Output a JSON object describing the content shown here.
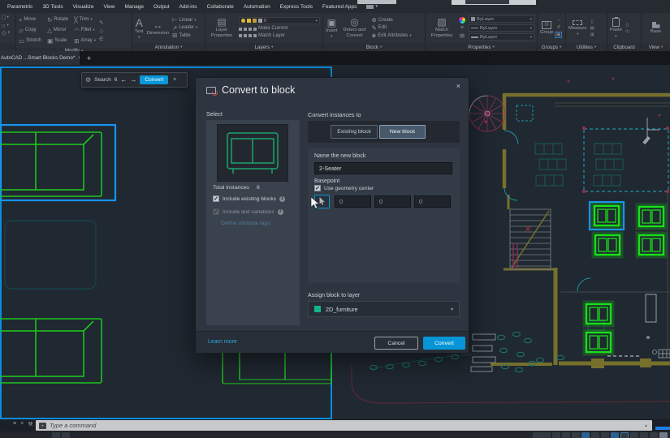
{
  "app": {
    "drawing_tab": "AutoCAD ...Smart Blocks Demo*"
  },
  "menu": {
    "items": [
      "Parametric",
      "3D Tools",
      "Visualize",
      "View",
      "Manage",
      "Output",
      "Add-ins",
      "Collaborate",
      "Automation",
      "Express Tools",
      "Featured Apps"
    ]
  },
  "ribbon": {
    "modify": {
      "label": "Modify",
      "move": "Move",
      "rotate": "Rotate",
      "trim": "Trim",
      "copy": "Copy",
      "mirror": "Mirror",
      "fillet": "Fillet",
      "stretch": "Stretch",
      "scale": "Scale",
      "array": "Array"
    },
    "annotation": {
      "label": "Annotation",
      "text": "Text",
      "dimension": "Dimension",
      "linear": "Linear",
      "leader": "Leader",
      "table": "Table"
    },
    "layers": {
      "label": "Layers",
      "layer_properties": "Layer Properties",
      "current_layer": "0",
      "make_current": "Make Current",
      "match_layer": "Match Layer"
    },
    "block": {
      "label": "Block",
      "insert": "Insert",
      "detect_convert": "Detect and Convert",
      "create": "Create",
      "edit": "Edit",
      "edit_attributes": "Edit Attributes"
    },
    "properties": {
      "label": "Properties",
      "match_properties": "Match Properties",
      "bylayer_color": "ByLayer",
      "bylayer_linetype": "ByLayer",
      "bylayer_lineweight": "ByLayer"
    },
    "groups": {
      "label": "Groups",
      "group": "Group"
    },
    "utilities": {
      "label": "Utilities",
      "measure": "Measure"
    },
    "clipboard": {
      "label": "Clipboard",
      "paste": "Paste"
    },
    "view": {
      "label": "View",
      "base": "Base"
    }
  },
  "finder": {
    "search_label": "Search",
    "count": "6",
    "convert": "Convert"
  },
  "dialog": {
    "title": "Convert to block",
    "select": {
      "label": "Select",
      "total_label": "Total instances",
      "total_value": "6",
      "include_existing": "Include existing blocks",
      "include_text": "Include text variations",
      "define_tags": "Define attribute tags"
    },
    "convert_to": {
      "label": "Convert instances to",
      "existing_tab": "Existing block",
      "new_tab": "New block"
    },
    "name": {
      "label": "Name the new block",
      "value": "2-Seater"
    },
    "basepoint": {
      "label": "Basepoint",
      "geometry_center": "Use geometry center",
      "x": "0",
      "y": "0",
      "z": "0"
    },
    "assign": {
      "label": "Assign block to layer",
      "layer": "2D_furniture"
    },
    "footer": {
      "learn_more": "Learn more",
      "cancel": "Cancel",
      "convert": "Convert"
    }
  },
  "commandline": {
    "placeholder": "Type a command"
  },
  "icons": {
    "caret": "▾",
    "gear": "⚙",
    "arrow_left": "←",
    "arrow_right": "→",
    "close": "×",
    "check": "✓",
    "info": "i",
    "move": "+",
    "rotate": "↻",
    "trim": "╳",
    "copy": "▱",
    "mirror": "△",
    "fillet": "◠",
    "stretch": "▭",
    "scale": "▣",
    "array": "⊞",
    "pencil": "✎",
    "polygon": "◇",
    "member": "∈",
    "text": "A",
    "dimension": "↔",
    "linear": "⊢",
    "leader": "↗",
    "table": "⊞",
    "layer_stack": "▤",
    "insert": "▣",
    "detect": "◎",
    "create": "⊕",
    "edit": "✎",
    "edit_attr": "◈",
    "match_props": "▨",
    "group": "⊙",
    "menu_list": "≡",
    "wrench": "⚒",
    "up": "▴",
    "rect_tool": "□",
    "circle_tool": "○",
    "poly_tool": "◇",
    "g1": "▫",
    "g2": "↺",
    "g3": "▦",
    "u1": "▯",
    "u2": "▤",
    "u3": "⊞",
    "c1": "▯",
    "c2": "▭"
  },
  "colors": {
    "accent_blue": "#0696d7",
    "selection_blue": "#1794f0",
    "block_green": "#17e017",
    "layer_swatch_green": "#14b389",
    "wall_olive": "#76702c"
  }
}
